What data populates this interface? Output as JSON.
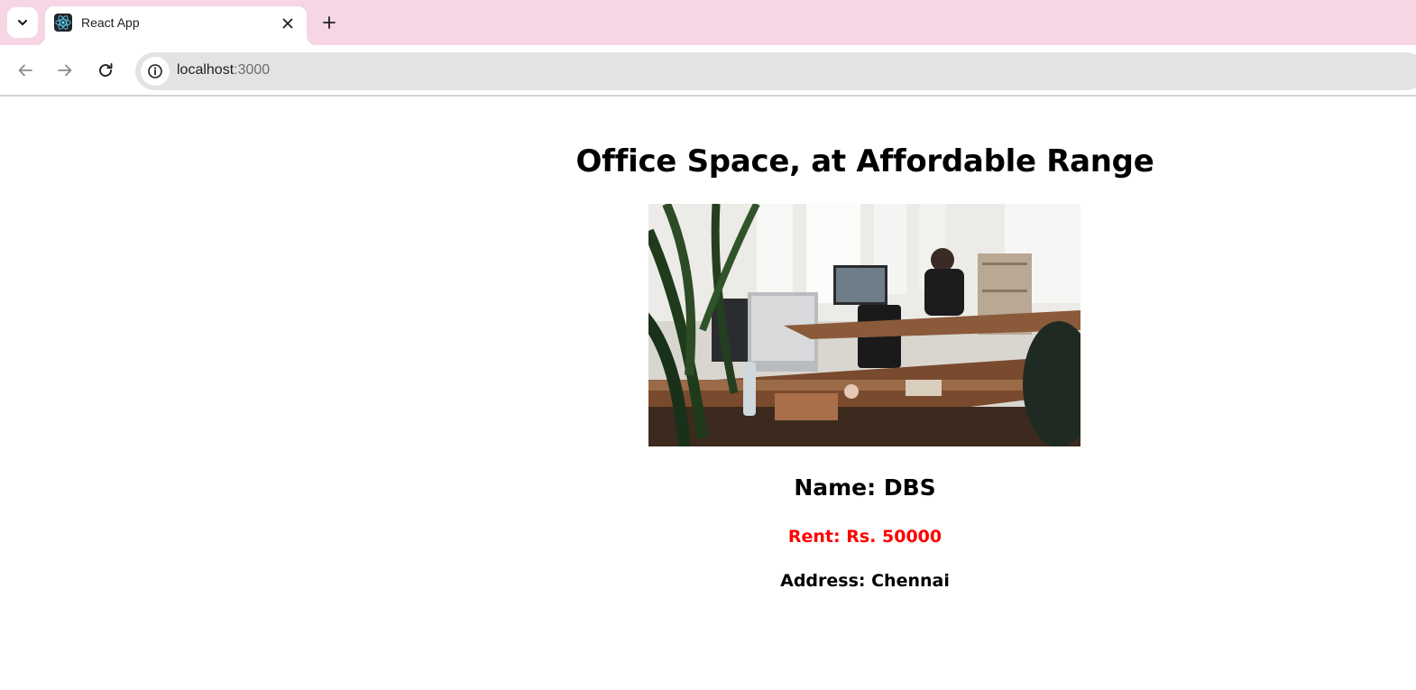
{
  "browser": {
    "tab": {
      "title": "React App",
      "favicon": "react-logo-icon"
    },
    "address": {
      "host": "localhost",
      "port": ":3000"
    },
    "icons": {
      "tab_search": "chevron-down-icon",
      "close": "close-icon",
      "new_tab": "plus-icon",
      "back": "arrow-left-icon",
      "forward": "arrow-right-icon",
      "reload": "reload-icon",
      "site_info": "info-icon"
    },
    "colors": {
      "tabstrip": "#f6d5e4",
      "omnibox": "#e3e3e3"
    }
  },
  "page": {
    "heading": "Office Space, at Affordable Range",
    "image": {
      "subject": "office-workspace-photo"
    },
    "office": {
      "name_text": "Name: DBS",
      "rent_text": "Rent: Rs. 50000",
      "address_text": "Address: Chennai",
      "rent_color": "#ff0000"
    }
  }
}
